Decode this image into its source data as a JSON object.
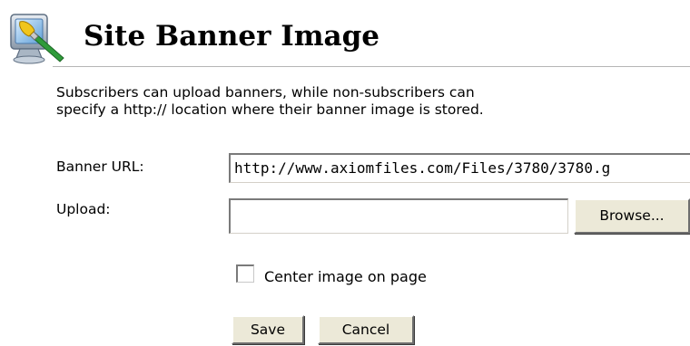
{
  "header": {
    "title": "Site Banner Image",
    "icon": "monitor-brush-icon"
  },
  "description": {
    "line1": "Subscribers can upload banners, while non-subscribers can",
    "line2": "specify a http:// location where their banner image is stored."
  },
  "form": {
    "banner_url_label": "Banner URL:",
    "banner_url_value": "http://www.axiomfiles.com/Files/3780/3780.g",
    "upload_label": "Upload:",
    "upload_value": "",
    "browse_label": "Browse...",
    "center_label": "Center image on page",
    "center_checked": false,
    "save_label": "Save",
    "cancel_label": "Cancel"
  },
  "colors": {
    "button_face": "#ece9d8",
    "rule": "#b5b5b5"
  }
}
